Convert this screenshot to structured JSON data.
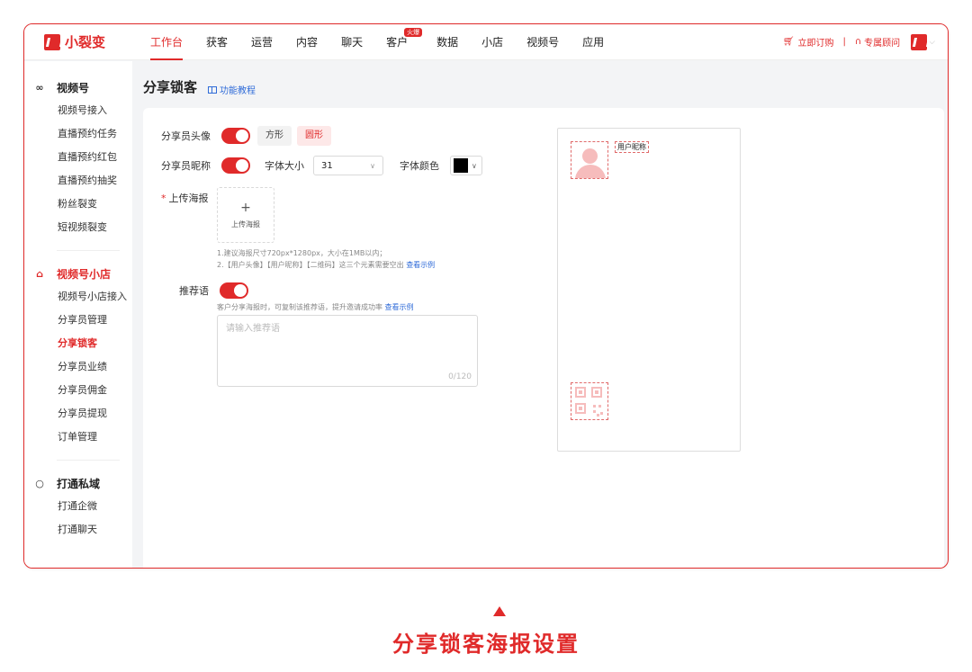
{
  "brand": {
    "name": "小裂变",
    "accent": "#e02a2a",
    "link": "#2f6bd8"
  },
  "topnav": {
    "items": [
      {
        "label": "工作台",
        "active": true
      },
      {
        "label": "获客"
      },
      {
        "label": "运营"
      },
      {
        "label": "内容"
      },
      {
        "label": "聊天"
      },
      {
        "label": "客户",
        "badge": "火爆"
      },
      {
        "label": "数据"
      },
      {
        "label": "小店"
      },
      {
        "label": "视频号"
      },
      {
        "label": "应用"
      }
    ],
    "order_label": "立即订购",
    "advisor_label": "专属顾问"
  },
  "sidebar": {
    "sections": [
      {
        "title": "视频号",
        "icon": "infinity-icon",
        "items": [
          "视频号接入",
          "直播预约任务",
          "直播预约红包",
          "直播预约抽奖",
          "粉丝裂变",
          "短视频裂变"
        ]
      },
      {
        "title": "视频号小店",
        "icon": "shop-icon",
        "items": [
          "视频号小店接入",
          "分享员管理",
          "分享锁客",
          "分享员业绩",
          "分享员佣金",
          "分享员提现",
          "订单管理"
        ]
      },
      {
        "title": "打通私域",
        "icon": "chat-icon",
        "items": [
          "打通企微",
          "打通聊天"
        ]
      }
    ],
    "active_item": "分享锁客"
  },
  "page": {
    "title": "分享锁客",
    "tutorial_link": "功能教程"
  },
  "form": {
    "avatar_label": "分享员头像",
    "avatar_toggle": "on",
    "shape_options": [
      "方形",
      "圆形"
    ],
    "shape_selected": "圆形",
    "nickname_label": "分享员昵称",
    "nickname_toggle": "on",
    "font_size_label": "字体大小",
    "font_size_value": "31",
    "font_color_label": "字体颜色",
    "font_color_value": "#000000",
    "upload_label": "上传海报",
    "upload_button": "上传海报",
    "hint1": "1.建议海报尺寸720px*1280px，大小在1MB以内；",
    "hint2": "2.【用户头像】【用户昵称】【二维码】这三个元素需要空出",
    "hint2_link": "查看示例",
    "recommend_label": "推荐语",
    "recommend_toggle": "on",
    "recommend_hint": "客户分享海报时，可复制该推荐语，提升邀请成功率",
    "recommend_hint_link": "查看示例",
    "recommend_placeholder": "请输入推荐语",
    "recommend_count": "0/120"
  },
  "preview": {
    "nickname": "用户昵称"
  },
  "caption": "分享锁客海报设置"
}
